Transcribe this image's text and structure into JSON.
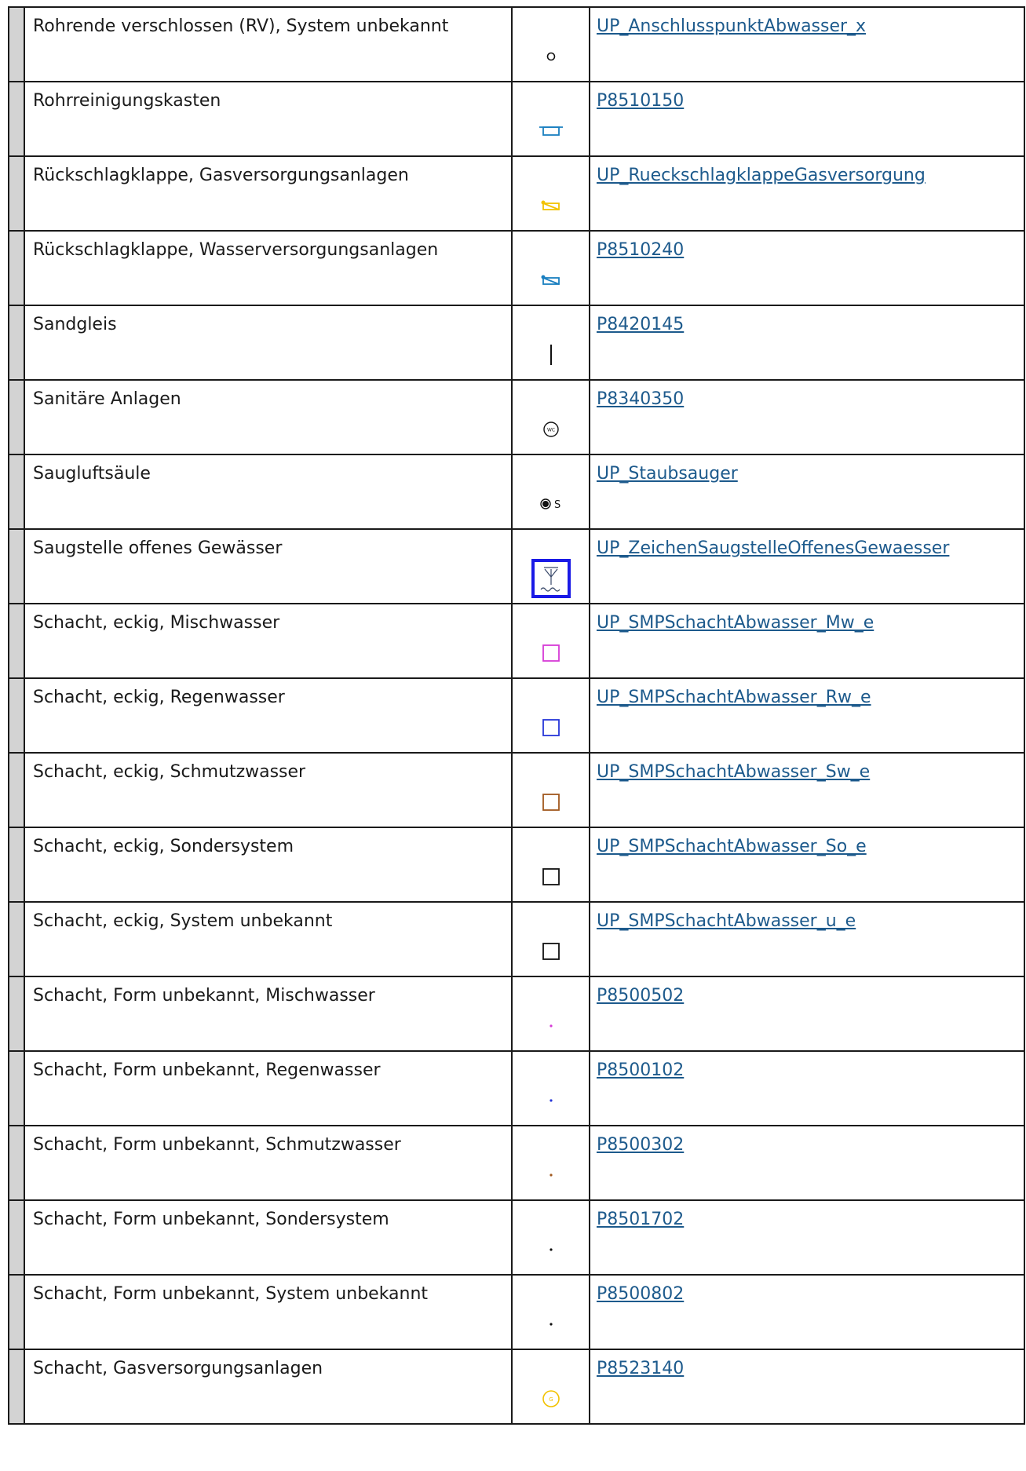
{
  "rows": [
    {
      "name": "Rohrende verschlossen (RV), System unbekannt",
      "symbol": "circle-outline-small-icon",
      "code": "UP_AnschlusspunktAbwasser_x"
    },
    {
      "name": "Rohrreinigungskasten",
      "symbol": "cleaning-box-icon",
      "code": "P8510150"
    },
    {
      "name": "Rückschlagklappe, Gasversorgungsanlagen",
      "symbol": "check-valve-gas-icon",
      "code": "UP_RueckschlagklappeGasversorgung"
    },
    {
      "name": "Rückschlagklappe, Wasserversorgungsanlagen",
      "symbol": "check-valve-water-icon",
      "code": "P8510240"
    },
    {
      "name": "Sandgleis",
      "symbol": "vertical-line-icon",
      "code": "P8420145"
    },
    {
      "name": "Sanitäre Anlagen",
      "symbol": "wc-circle-icon",
      "code": "P8340350"
    },
    {
      "name": "Saugluftsäule",
      "symbol": "vacuum-column-icon",
      "code": "UP_Staubsauger"
    },
    {
      "name": "Saugstelle offenes Gewässer",
      "symbol": "suction-point-icon",
      "code": "UP_ZeichenSaugstelleOffenesGewaesser"
    },
    {
      "name": "Schacht, eckig, Mischwasser",
      "symbol": "square-magenta-icon",
      "code": "UP_SMPSchachtAbwasser_Mw_e"
    },
    {
      "name": "Schacht, eckig, Regenwasser",
      "symbol": "square-blue-icon",
      "code": "UP_SMPSchachtAbwasser_Rw_e"
    },
    {
      "name": "Schacht, eckig, Schmutzwasser",
      "symbol": "square-brown-icon",
      "code": "UP_SMPSchachtAbwasser_Sw_e"
    },
    {
      "name": "Schacht, eckig, Sondersystem",
      "symbol": "square-black-icon",
      "code": "UP_SMPSchachtAbwasser_So_e"
    },
    {
      "name": "Schacht, eckig, System unbekannt",
      "symbol": "square-black-icon",
      "code": "UP_SMPSchachtAbwasser_u_e"
    },
    {
      "name": "Schacht, Form unbekannt, Mischwasser",
      "symbol": "dot-magenta-icon",
      "code": "P8500502"
    },
    {
      "name": "Schacht, Form unbekannt, Regenwasser",
      "symbol": "dot-blue-icon",
      "code": "P8500102"
    },
    {
      "name": "Schacht, Form unbekannt, Schmutzwasser",
      "symbol": "dot-brown-icon",
      "code": "P8500302"
    },
    {
      "name": "Schacht, Form unbekannt, Sondersystem",
      "symbol": "dot-black-icon",
      "code": "P8501702"
    },
    {
      "name": "Schacht, Form unbekannt, System unbekannt",
      "symbol": "dot-black-icon",
      "code": "P8500802"
    },
    {
      "name": "Schacht, Gasversorgungsanlagen",
      "symbol": "gas-manhole-icon",
      "code": "P8523140"
    }
  ],
  "colors": {
    "magenta": "#d63ad6",
    "blue": "#2636d9",
    "brown": "#a0581e",
    "black": "#111111",
    "gas_yellow": "#f2c200",
    "water_blue": "#1a7fc0",
    "suction_blue": "#1a1ae6",
    "link": "#1d5a8c",
    "gutter": "#d3d3d3"
  }
}
